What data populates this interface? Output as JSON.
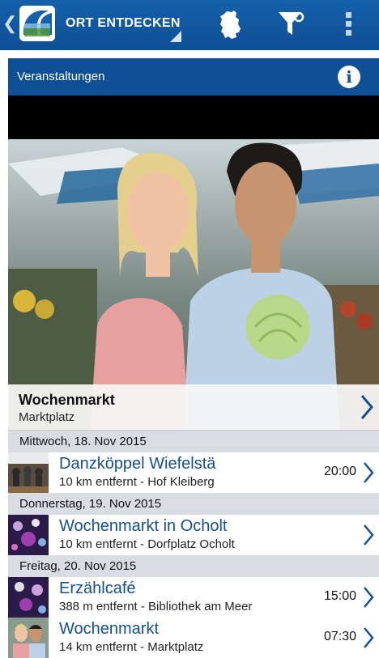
{
  "app": {
    "title": "ORT ENTDECKEN"
  },
  "icons": {
    "back": "chevron-left-icon",
    "logo": "app-logo-icon",
    "map": "germany-map-icon",
    "filter": "filter-icon",
    "menu": "overflow-menu-icon",
    "info": "info-icon",
    "chevron": "chevron-right-icon"
  },
  "colors": {
    "primary": "#0f4f95",
    "link": "#134f95",
    "day_bg": "#d9dde3"
  },
  "section": {
    "title": "Veranstaltungen",
    "info_glyph": "i"
  },
  "featured": {
    "title": "Wochenmarkt",
    "subtitle": "Marktplatz"
  },
  "days": [
    {
      "label": "Mittwoch, 18. Nov 2015",
      "events": [
        {
          "title": "Danzköppel Wiefelstä",
          "subtitle": "10 km entfernt - Hof Kleiberg",
          "time": "20:00"
        }
      ]
    },
    {
      "label": "Donnerstag, 19. Nov 2015",
      "events": [
        {
          "title": "Wochenmarkt in Ocholt",
          "subtitle": "10 km entfernt - Dorfplatz Ocholt",
          "time": ""
        }
      ]
    },
    {
      "label": "Freitag, 20. Nov 2015",
      "events": [
        {
          "title": "Erzählcafé",
          "subtitle": "388 m entfernt - Bibliothek am Meer",
          "time": "15:00"
        },
        {
          "title": "Wochenmarkt",
          "subtitle": "14 km entfernt - Marktplatz",
          "time": "07:30"
        }
      ]
    }
  ]
}
